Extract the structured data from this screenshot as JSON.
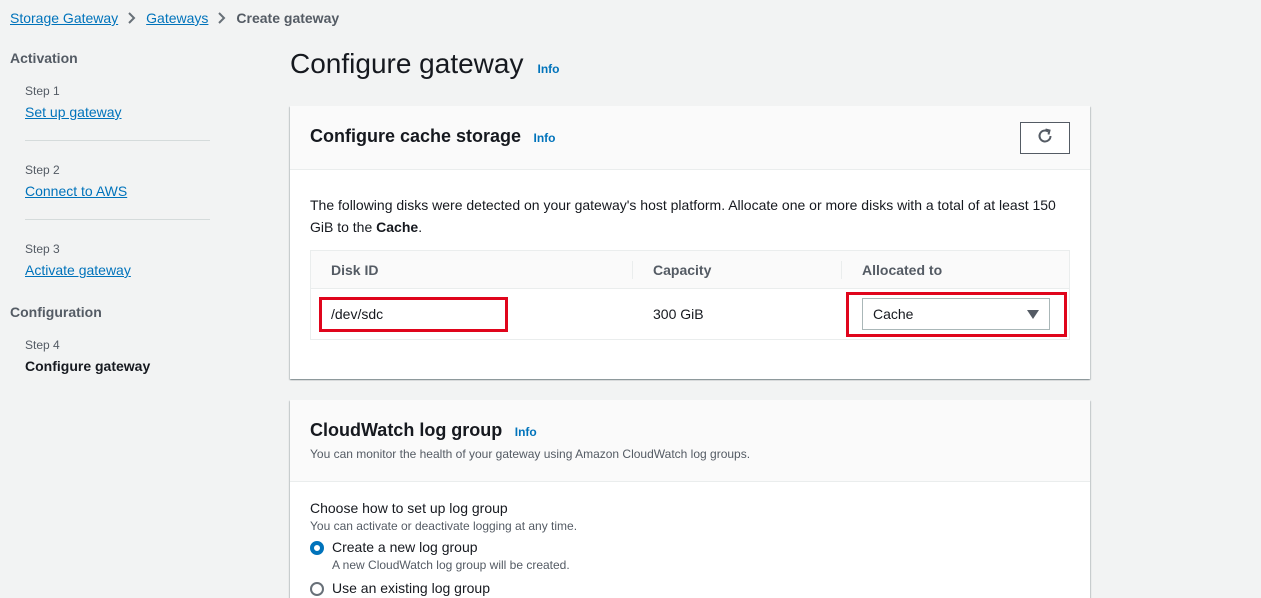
{
  "breadcrumb": {
    "items": [
      "Storage Gateway",
      "Gateways"
    ],
    "current": "Create gateway"
  },
  "nav": {
    "activation_heading": "Activation",
    "configuration_heading": "Configuration",
    "steps": [
      {
        "label": "Step 1",
        "title": "Set up gateway"
      },
      {
        "label": "Step 2",
        "title": "Connect to AWS"
      },
      {
        "label": "Step 3",
        "title": "Activate gateway"
      },
      {
        "label": "Step 4",
        "title": "Configure gateway"
      }
    ]
  },
  "page": {
    "title": "Configure gateway",
    "info": "Info"
  },
  "cache_panel": {
    "title": "Configure cache storage",
    "info": "Info",
    "refresh_icon": "refresh-icon",
    "description_prefix": "The following disks were detected on your gateway's host platform. Allocate one or more disks with a total of at least 150 GiB to the ",
    "description_bold": "Cache",
    "description_suffix": ".",
    "columns": [
      "Disk ID",
      "Capacity",
      "Allocated to"
    ],
    "rows": [
      {
        "disk_id": "/dev/sdc",
        "capacity": "300 GiB",
        "allocated_to": "Cache"
      }
    ]
  },
  "cloudwatch_panel": {
    "title": "CloudWatch log group",
    "info": "Info",
    "subtitle": "You can monitor the health of your gateway using Amazon CloudWatch log groups.",
    "field_label": "Choose how to set up log group",
    "field_hint": "You can activate or deactivate logging at any time.",
    "options": [
      {
        "label": "Create a new log group",
        "description": "A new CloudWatch log group will be created.",
        "selected": true
      },
      {
        "label": "Use an existing log group",
        "description": "",
        "selected": false
      }
    ]
  },
  "colors": {
    "link": "#0073bb",
    "highlight": "#e0051c",
    "background": "#f2f3f3"
  }
}
